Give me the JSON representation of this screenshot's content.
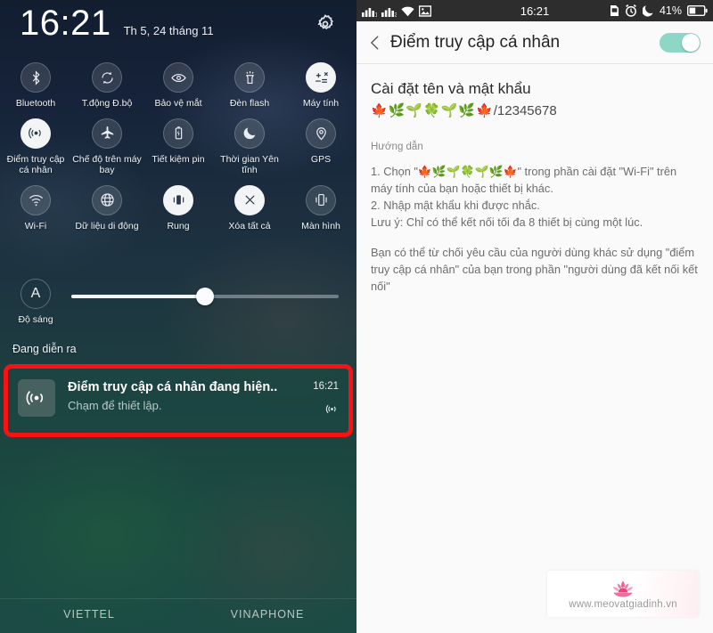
{
  "left_panel": {
    "clock": {
      "time": "16:21",
      "date": "Th 5, 24 tháng 11"
    },
    "settings_gear": "gear-icon",
    "toggles": [
      {
        "label": "Bluetooth",
        "icon": "bluetooth-icon",
        "active": false
      },
      {
        "label": "T.động Đ.bộ",
        "icon": "sync-icon",
        "active": false
      },
      {
        "label": "Bảo vệ mắt",
        "icon": "eye-icon",
        "active": false
      },
      {
        "label": "Đèn flash",
        "icon": "flashlight-icon",
        "active": false
      },
      {
        "label": "Máy tính",
        "icon": "calculator-icon",
        "active": true
      },
      {
        "label": "Điểm truy cập cá nhân",
        "icon": "hotspot-icon",
        "active": true
      },
      {
        "label": "Chế độ trên máy bay",
        "icon": "airplane-icon",
        "active": false
      },
      {
        "label": "Tiết kiệm pin",
        "icon": "battery-saver-icon",
        "active": false
      },
      {
        "label": "Thời gian Yên tĩnh",
        "icon": "moon-icon",
        "active": false
      },
      {
        "label": "GPS",
        "icon": "location-pin-icon",
        "active": false
      },
      {
        "label": "Wi-Fi",
        "icon": "wifi-icon",
        "active": false
      },
      {
        "label": "Dữ liệu di động",
        "icon": "globe-icon",
        "active": false
      },
      {
        "label": "Rung",
        "icon": "vibrate-icon",
        "active": true
      },
      {
        "label": "Xóa tất cả",
        "icon": "close-x-icon",
        "active": true
      },
      {
        "label": "Màn hình",
        "icon": "screen-rotate-icon",
        "active": false
      }
    ],
    "brightness": {
      "badge": "A",
      "label": "Độ sáng",
      "value_percent": 50
    },
    "ongoing_label": "Đang diễn ra",
    "notification": {
      "title": "Điểm truy cập cá nhân đang hiện..",
      "subtitle": "Chạm để thiết lập.",
      "time": "16:21",
      "app_icon": "hotspot-icon",
      "small_icon": "hotspot-icon"
    },
    "carriers": [
      "VIETTEL",
      "VINAPHONE"
    ]
  },
  "right_panel": {
    "statusbar": {
      "signal_sim1": "signal-bars-icon",
      "signal_sim2": "signal-bars-2-icon",
      "wifi": "wifi-icon",
      "photo": "image-icon",
      "time": "16:21",
      "sim": "sim-card-icon",
      "alarm": "alarm-clock-icon",
      "dnd": "moon-icon",
      "battery_percent": "41%",
      "battery": "battery-icon"
    },
    "appbar": {
      "back": "chevron-left-icon",
      "title": "Điểm truy cập cá nhân",
      "toggle_on": true
    },
    "section": {
      "title": "Cài đặt tên và mật khẩu",
      "ssid_emoji": "🍁🌿🌱🍀🌱🌿🍁",
      "password": "/12345678"
    },
    "guide": {
      "label": "Hướng dẫn",
      "line1": "1. Chọn \"🍁🌿🌱🍀🌱🌿🍁\" trong phần cài đặt \"Wi-Fi\" trên máy tính của bạn hoặc thiết bị khác.",
      "line2": "2. Nhập mật khẩu khi được nhắc.",
      "line3": "Lưu ý: Chỉ có thể kết nối tối đa 8 thiết bị cùng một lúc.",
      "line4": "Bạn có thể từ chối yêu cầu của người dùng khác sử dụng \"điểm truy cập cá nhân\" của bạn trong phần \"người dùng đã kết nối kết nối\""
    },
    "watermark": {
      "logo": "lotus-logo-icon",
      "text": "www.meovatgiadinh.vn"
    }
  },
  "colors": {
    "accent_teal": "#8ed6c6",
    "highlight_red": "#fb1112",
    "statusbar_bg": "#2d2d2d",
    "watermark_pink": "#e8477f"
  }
}
